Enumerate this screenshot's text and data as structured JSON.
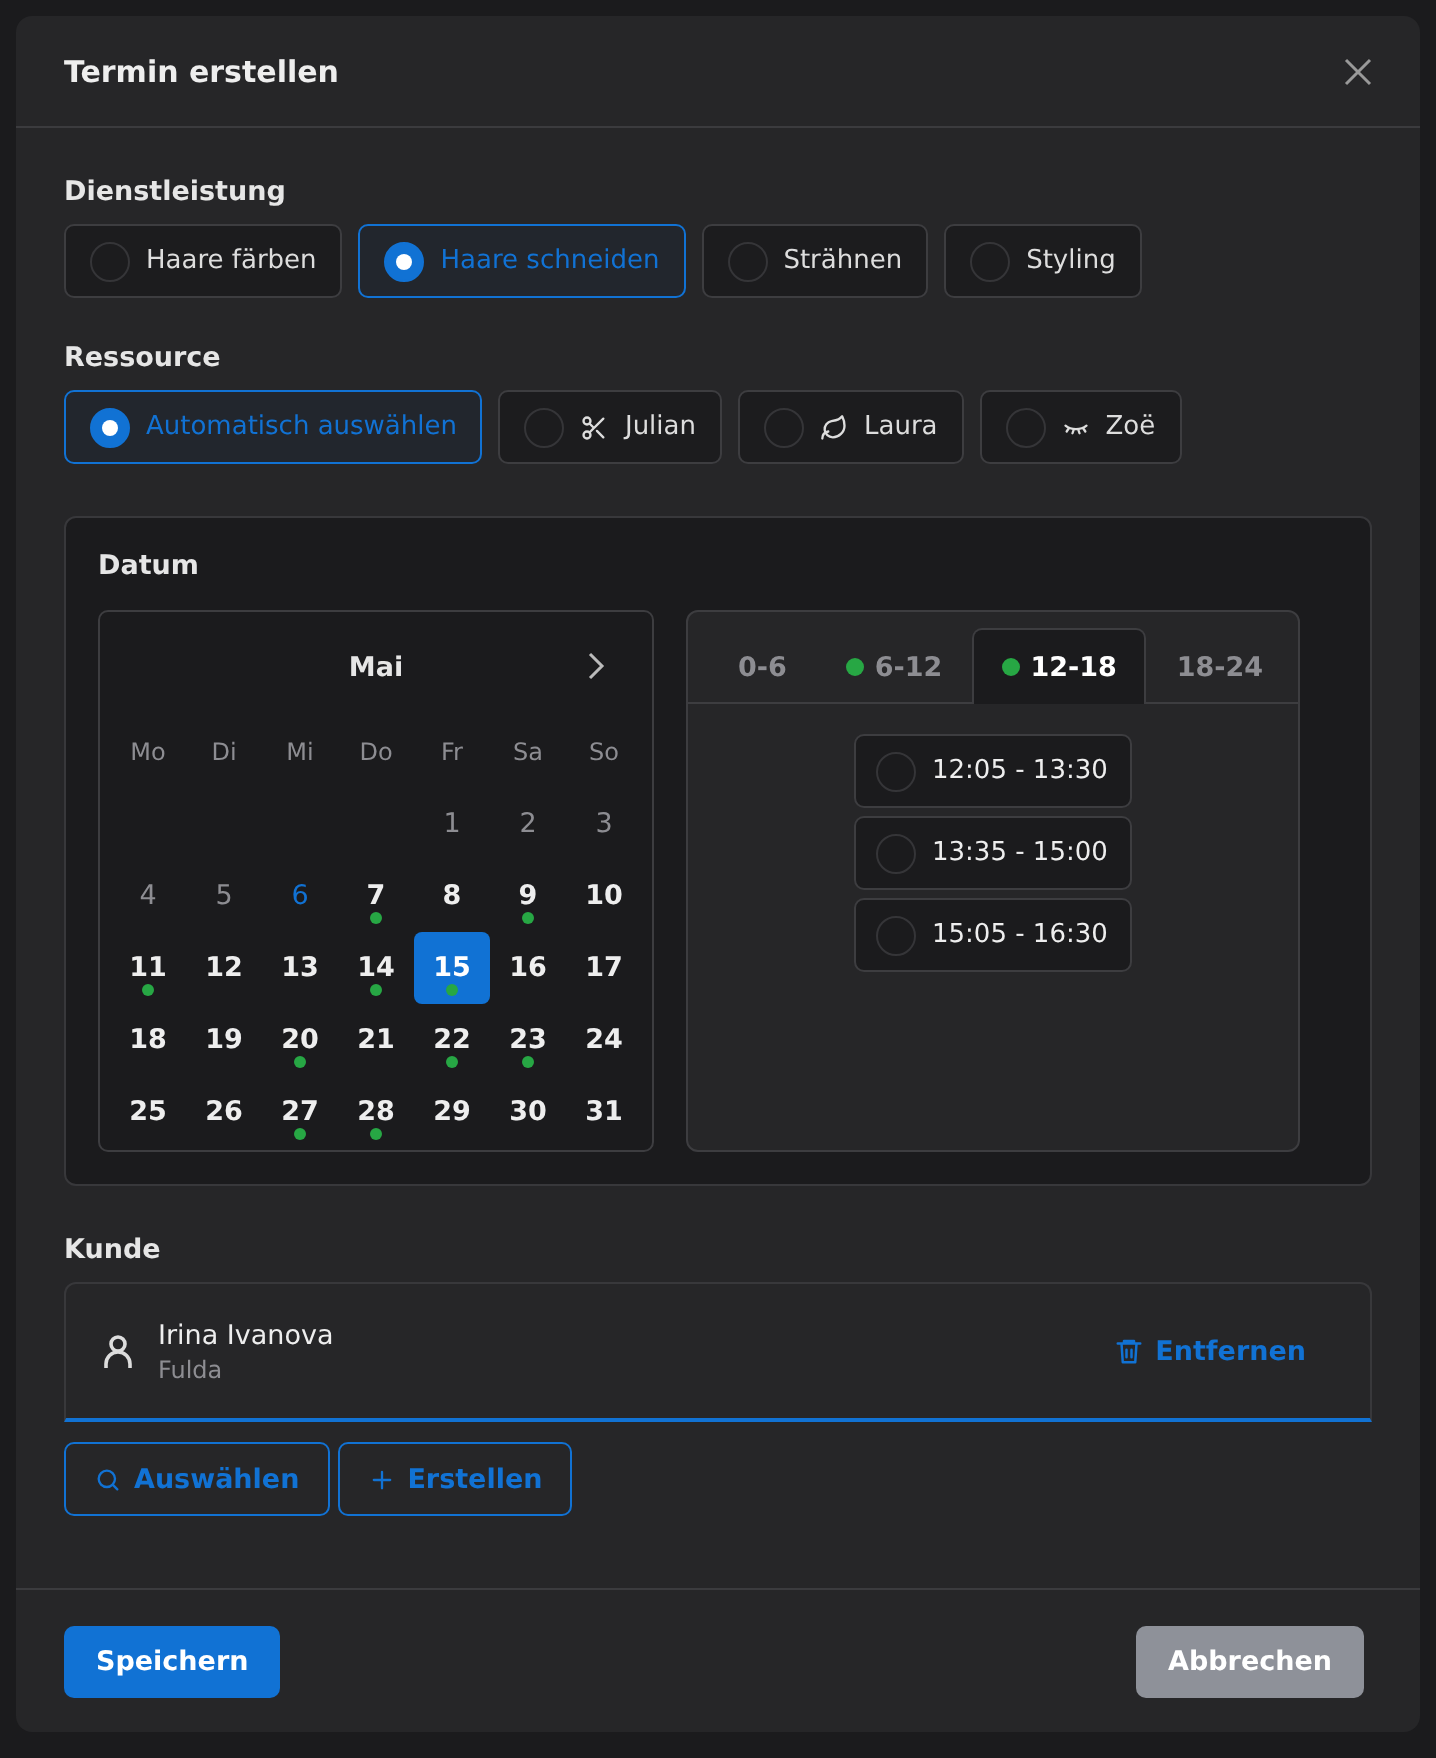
{
  "dialog": {
    "title": "Termin erstellen"
  },
  "service": {
    "label": "Dienstleistung",
    "options": [
      {
        "label": "Haare färben",
        "selected": false
      },
      {
        "label": "Haare schneiden",
        "selected": true
      },
      {
        "label": "Strähnen",
        "selected": false
      },
      {
        "label": "Styling",
        "selected": false
      }
    ]
  },
  "resource": {
    "label": "Ressource",
    "options": [
      {
        "label": "Automatisch auswählen",
        "selected": true,
        "kind": "plain"
      },
      {
        "label": "Julian",
        "selected": false,
        "kind": "scissors"
      },
      {
        "label": "Laura",
        "selected": false,
        "kind": "leaf"
      },
      {
        "label": "Zoë",
        "selected": false,
        "kind": "lashes"
      }
    ]
  },
  "date": {
    "label": "Datum",
    "calendar": {
      "month": "Mai",
      "weekdays": [
        "Mo",
        "Di",
        "Mi",
        "Do",
        "Fr",
        "Sa",
        "So"
      ],
      "days": [
        {
          "kind": "blank"
        },
        {
          "kind": "blank"
        },
        {
          "kind": "blank"
        },
        {
          "kind": "blank"
        },
        {
          "kind": "day",
          "label": "1",
          "past": true,
          "today": false,
          "available": false,
          "selected": false
        },
        {
          "kind": "day",
          "label": "2",
          "past": true,
          "today": false,
          "available": false,
          "selected": false
        },
        {
          "kind": "day",
          "label": "3",
          "past": true,
          "today": false,
          "available": false,
          "selected": false
        },
        {
          "kind": "day",
          "label": "4",
          "past": true,
          "today": false,
          "available": false,
          "selected": false
        },
        {
          "kind": "day",
          "label": "5",
          "past": true,
          "today": false,
          "available": false,
          "selected": false
        },
        {
          "kind": "day",
          "label": "6",
          "past": false,
          "today": true,
          "available": false,
          "selected": false
        },
        {
          "kind": "day",
          "label": "7",
          "past": false,
          "today": false,
          "available": true,
          "selected": false
        },
        {
          "kind": "day",
          "label": "8",
          "past": false,
          "today": false,
          "available": false,
          "selected": false
        },
        {
          "kind": "day",
          "label": "9",
          "past": false,
          "today": false,
          "available": true,
          "selected": false
        },
        {
          "kind": "day",
          "label": "10",
          "past": false,
          "today": false,
          "available": false,
          "selected": false
        },
        {
          "kind": "day",
          "label": "11",
          "past": false,
          "today": false,
          "available": true,
          "selected": false
        },
        {
          "kind": "day",
          "label": "12",
          "past": false,
          "today": false,
          "available": false,
          "selected": false
        },
        {
          "kind": "day",
          "label": "13",
          "past": false,
          "today": false,
          "available": false,
          "selected": false
        },
        {
          "kind": "day",
          "label": "14",
          "past": false,
          "today": false,
          "available": true,
          "selected": false
        },
        {
          "kind": "day",
          "label": "15",
          "past": false,
          "today": false,
          "available": true,
          "selected": true
        },
        {
          "kind": "day",
          "label": "16",
          "past": false,
          "today": false,
          "available": false,
          "selected": false
        },
        {
          "kind": "day",
          "label": "17",
          "past": false,
          "today": false,
          "available": false,
          "selected": false
        },
        {
          "kind": "day",
          "label": "18",
          "past": false,
          "today": false,
          "available": false,
          "selected": false
        },
        {
          "kind": "day",
          "label": "19",
          "past": false,
          "today": false,
          "available": false,
          "selected": false
        },
        {
          "kind": "day",
          "label": "20",
          "past": false,
          "today": false,
          "available": true,
          "selected": false
        },
        {
          "kind": "day",
          "label": "21",
          "past": false,
          "today": false,
          "available": false,
          "selected": false
        },
        {
          "kind": "day",
          "label": "22",
          "past": false,
          "today": false,
          "available": true,
          "selected": false
        },
        {
          "kind": "day",
          "label": "23",
          "past": false,
          "today": false,
          "available": true,
          "selected": false
        },
        {
          "kind": "day",
          "label": "24",
          "past": false,
          "today": false,
          "available": false,
          "selected": false
        },
        {
          "kind": "day",
          "label": "25",
          "past": false,
          "today": false,
          "available": false,
          "selected": false
        },
        {
          "kind": "day",
          "label": "26",
          "past": false,
          "today": false,
          "available": false,
          "selected": false
        },
        {
          "kind": "day",
          "label": "27",
          "past": false,
          "today": false,
          "available": true,
          "selected": false
        },
        {
          "kind": "day",
          "label": "28",
          "past": false,
          "today": false,
          "available": true,
          "selected": false
        },
        {
          "kind": "day",
          "label": "29",
          "past": false,
          "today": false,
          "available": false,
          "selected": false
        },
        {
          "kind": "day",
          "label": "30",
          "past": false,
          "today": false,
          "available": false,
          "selected": false
        },
        {
          "kind": "day",
          "label": "31",
          "past": false,
          "today": false,
          "available": false,
          "selected": false
        }
      ]
    },
    "time_tabs": [
      {
        "label": "0-6",
        "selected": false,
        "available": false
      },
      {
        "label": "6-12",
        "selected": false,
        "available": true
      },
      {
        "label": "12-18",
        "selected": true,
        "available": true
      },
      {
        "label": "18-24",
        "selected": false,
        "available": false
      }
    ],
    "slots": [
      {
        "label": "12:05 - 13:30",
        "selected": false
      },
      {
        "label": "13:35 - 15:00",
        "selected": false
      },
      {
        "label": "15:05 - 16:30",
        "selected": false
      }
    ]
  },
  "customer": {
    "label": "Kunde",
    "name": "Irina Ivanova",
    "city": "Fulda",
    "remove": "Entfernen",
    "buttons": [
      {
        "label": "Auswählen",
        "kind": "search"
      },
      {
        "label": "Erstellen",
        "kind": "add"
      }
    ]
  },
  "footer": {
    "save": "Speichern",
    "cancel": "Abbrechen"
  }
}
